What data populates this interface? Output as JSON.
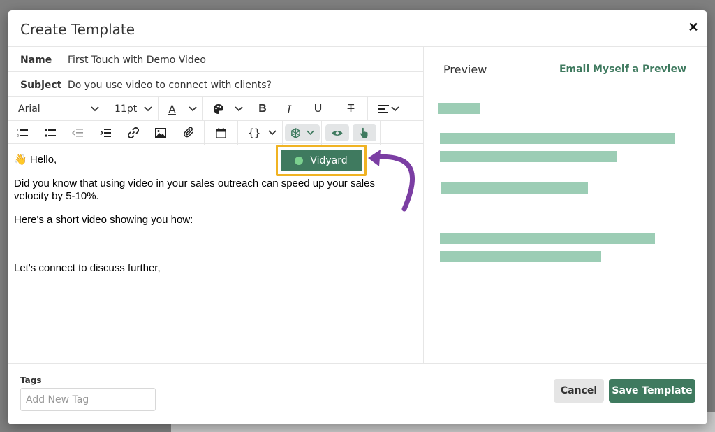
{
  "modal": {
    "title": "Create Template",
    "close_glyph": "✕"
  },
  "fields": {
    "name_label": "Name",
    "name_value": "First Touch with Demo Video",
    "subject_label": "Subject",
    "subject_value": "Do you use video to connect with clients?"
  },
  "toolbar": {
    "font_family": "Arial",
    "font_size": "11pt",
    "icons_row1": [
      "text-color-icon",
      "palette-icon",
      "bold-icon",
      "italic-icon",
      "underline-icon",
      "strikethrough-icon",
      "align-icon"
    ],
    "icons_row2": [
      "ordered-list-icon",
      "unordered-list-icon",
      "outdent-icon",
      "indent-icon",
      "link-icon",
      "image-icon",
      "attachment-icon",
      "calendar-icon",
      "variables-icon",
      "integrations-icon",
      "eye-icon",
      "pointer-icon"
    ],
    "variables_glyph": "{}",
    "bold_glyph": "B",
    "italic_glyph": "I",
    "underline_glyph": "U",
    "strike_glyph": "T",
    "text_color_glyph": "A"
  },
  "editor": {
    "greeting_emoji": "👋",
    "greeting": "Hello,",
    "paragraph1": "Did you know that using video in your sales outreach can speed up your sales velocity by 5-10%.",
    "paragraph2": "Here's a short video showing you how:",
    "paragraph3": "Let's connect to discuss further,"
  },
  "vidyard": {
    "label": "Vidyard"
  },
  "preview": {
    "title": "Preview",
    "email_link": "Email Myself a Preview"
  },
  "footer": {
    "tags_label": "Tags",
    "tag_placeholder": "Add New Tag",
    "cancel_label": "Cancel",
    "save_label": "Save Template"
  },
  "colors": {
    "brand_green": "#3f7a5f",
    "highlight": "#f0b323",
    "arrow_purple": "#7b3ea3",
    "placeholder_green": "#9ccdb5"
  }
}
